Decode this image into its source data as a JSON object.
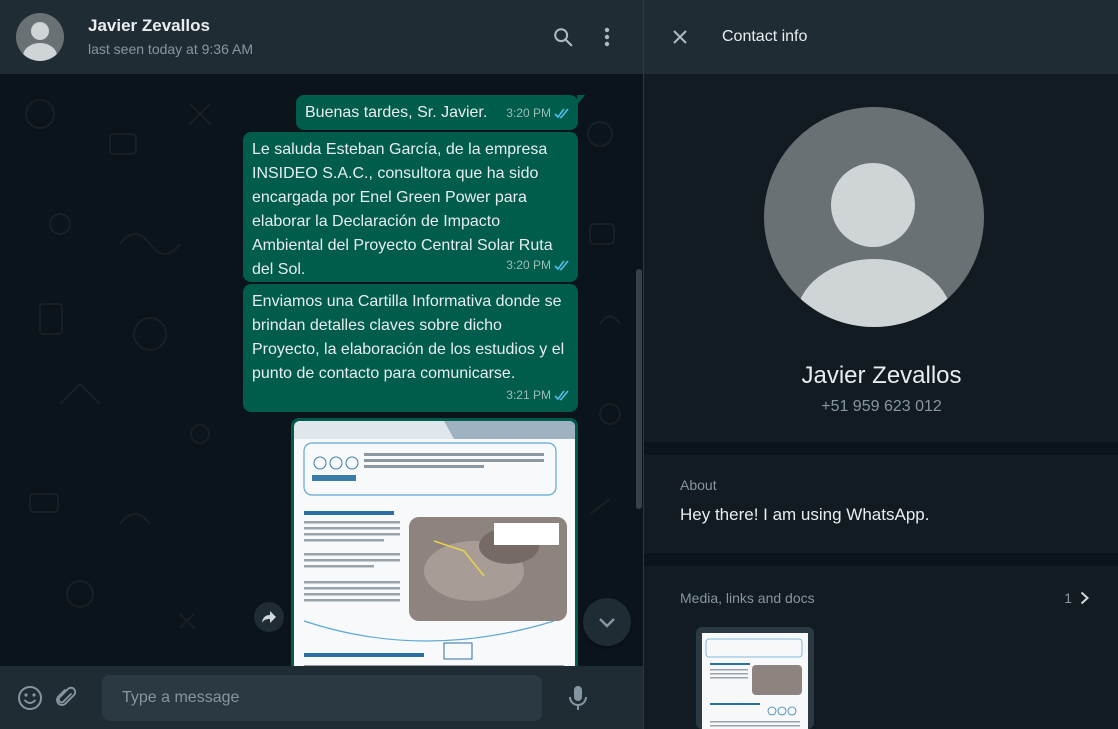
{
  "chat": {
    "contact_name": "Javier Zevallos",
    "last_seen": "last seen today at 9:36 AM",
    "messages": [
      {
        "text": "Buenas tardes, Sr. Javier.",
        "time": "3:20 PM"
      },
      {
        "text": "Le saluda Esteban García, de la empresa INSIDEO S.A.C., consultora que ha sido encargada por Enel Green Power para elaborar la Declaración de Impacto Ambiental del Proyecto Central Solar Ruta del Sol.",
        "time": "3:20 PM"
      },
      {
        "text": "Enviamos una Cartilla Informativa donde se brindan detalles claves sobre dicho Proyecto, la elaboración de los estudios y el punto de contacto para comunicarse.",
        "time": "3:21 PM"
      }
    ],
    "composer_placeholder": "Type a message"
  },
  "contact_info": {
    "title": "Contact info",
    "name": "Javier Zevallos",
    "phone": "+51 959 623 012",
    "about_label": "About",
    "about_text": "Hey there! I am using WhatsApp.",
    "media_label": "Media, links and docs",
    "media_count": "1"
  },
  "colors": {
    "outgoing_bubble": "#005c4b",
    "panel": "#202c33",
    "background": "#0b141a",
    "read_ticks": "#53bdeb"
  }
}
